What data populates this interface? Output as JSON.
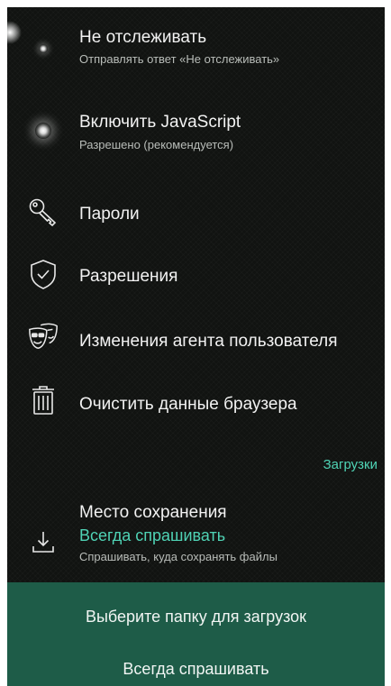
{
  "settings": {
    "dnt": {
      "title": "Не отслеживать",
      "subtitle": "Отправлять ответ «Не отслеживать»",
      "icon": "glow-dot-icon"
    },
    "javascript": {
      "title": "Включить JavaScript",
      "subtitle": "Разрешено (рекомендуется)",
      "icon": "glow-dot-icon"
    },
    "passwords": {
      "title": "Пароли",
      "icon": "key-icon"
    },
    "permissions": {
      "title": "Разрешения",
      "icon": "shield-check-icon"
    },
    "user_agent": {
      "title": "Изменения агента пользователя",
      "icon": "masks-icon"
    },
    "clear_data": {
      "title": "Очистить данные браузера",
      "icon": "trash-icon"
    }
  },
  "downloads": {
    "section_label": "Загрузки",
    "location": {
      "title": "Место сохранения",
      "value": "Всегда спрашивать",
      "subtitle": "Спрашивать, куда сохранять файлы",
      "icon": "download-icon"
    }
  },
  "sheet": {
    "title": "Выберите папку для загрузок",
    "option": "Всегда спрашивать"
  },
  "colors": {
    "background": "#111311",
    "accent": "#4fd3b5",
    "sheet": "#1e5c48"
  }
}
